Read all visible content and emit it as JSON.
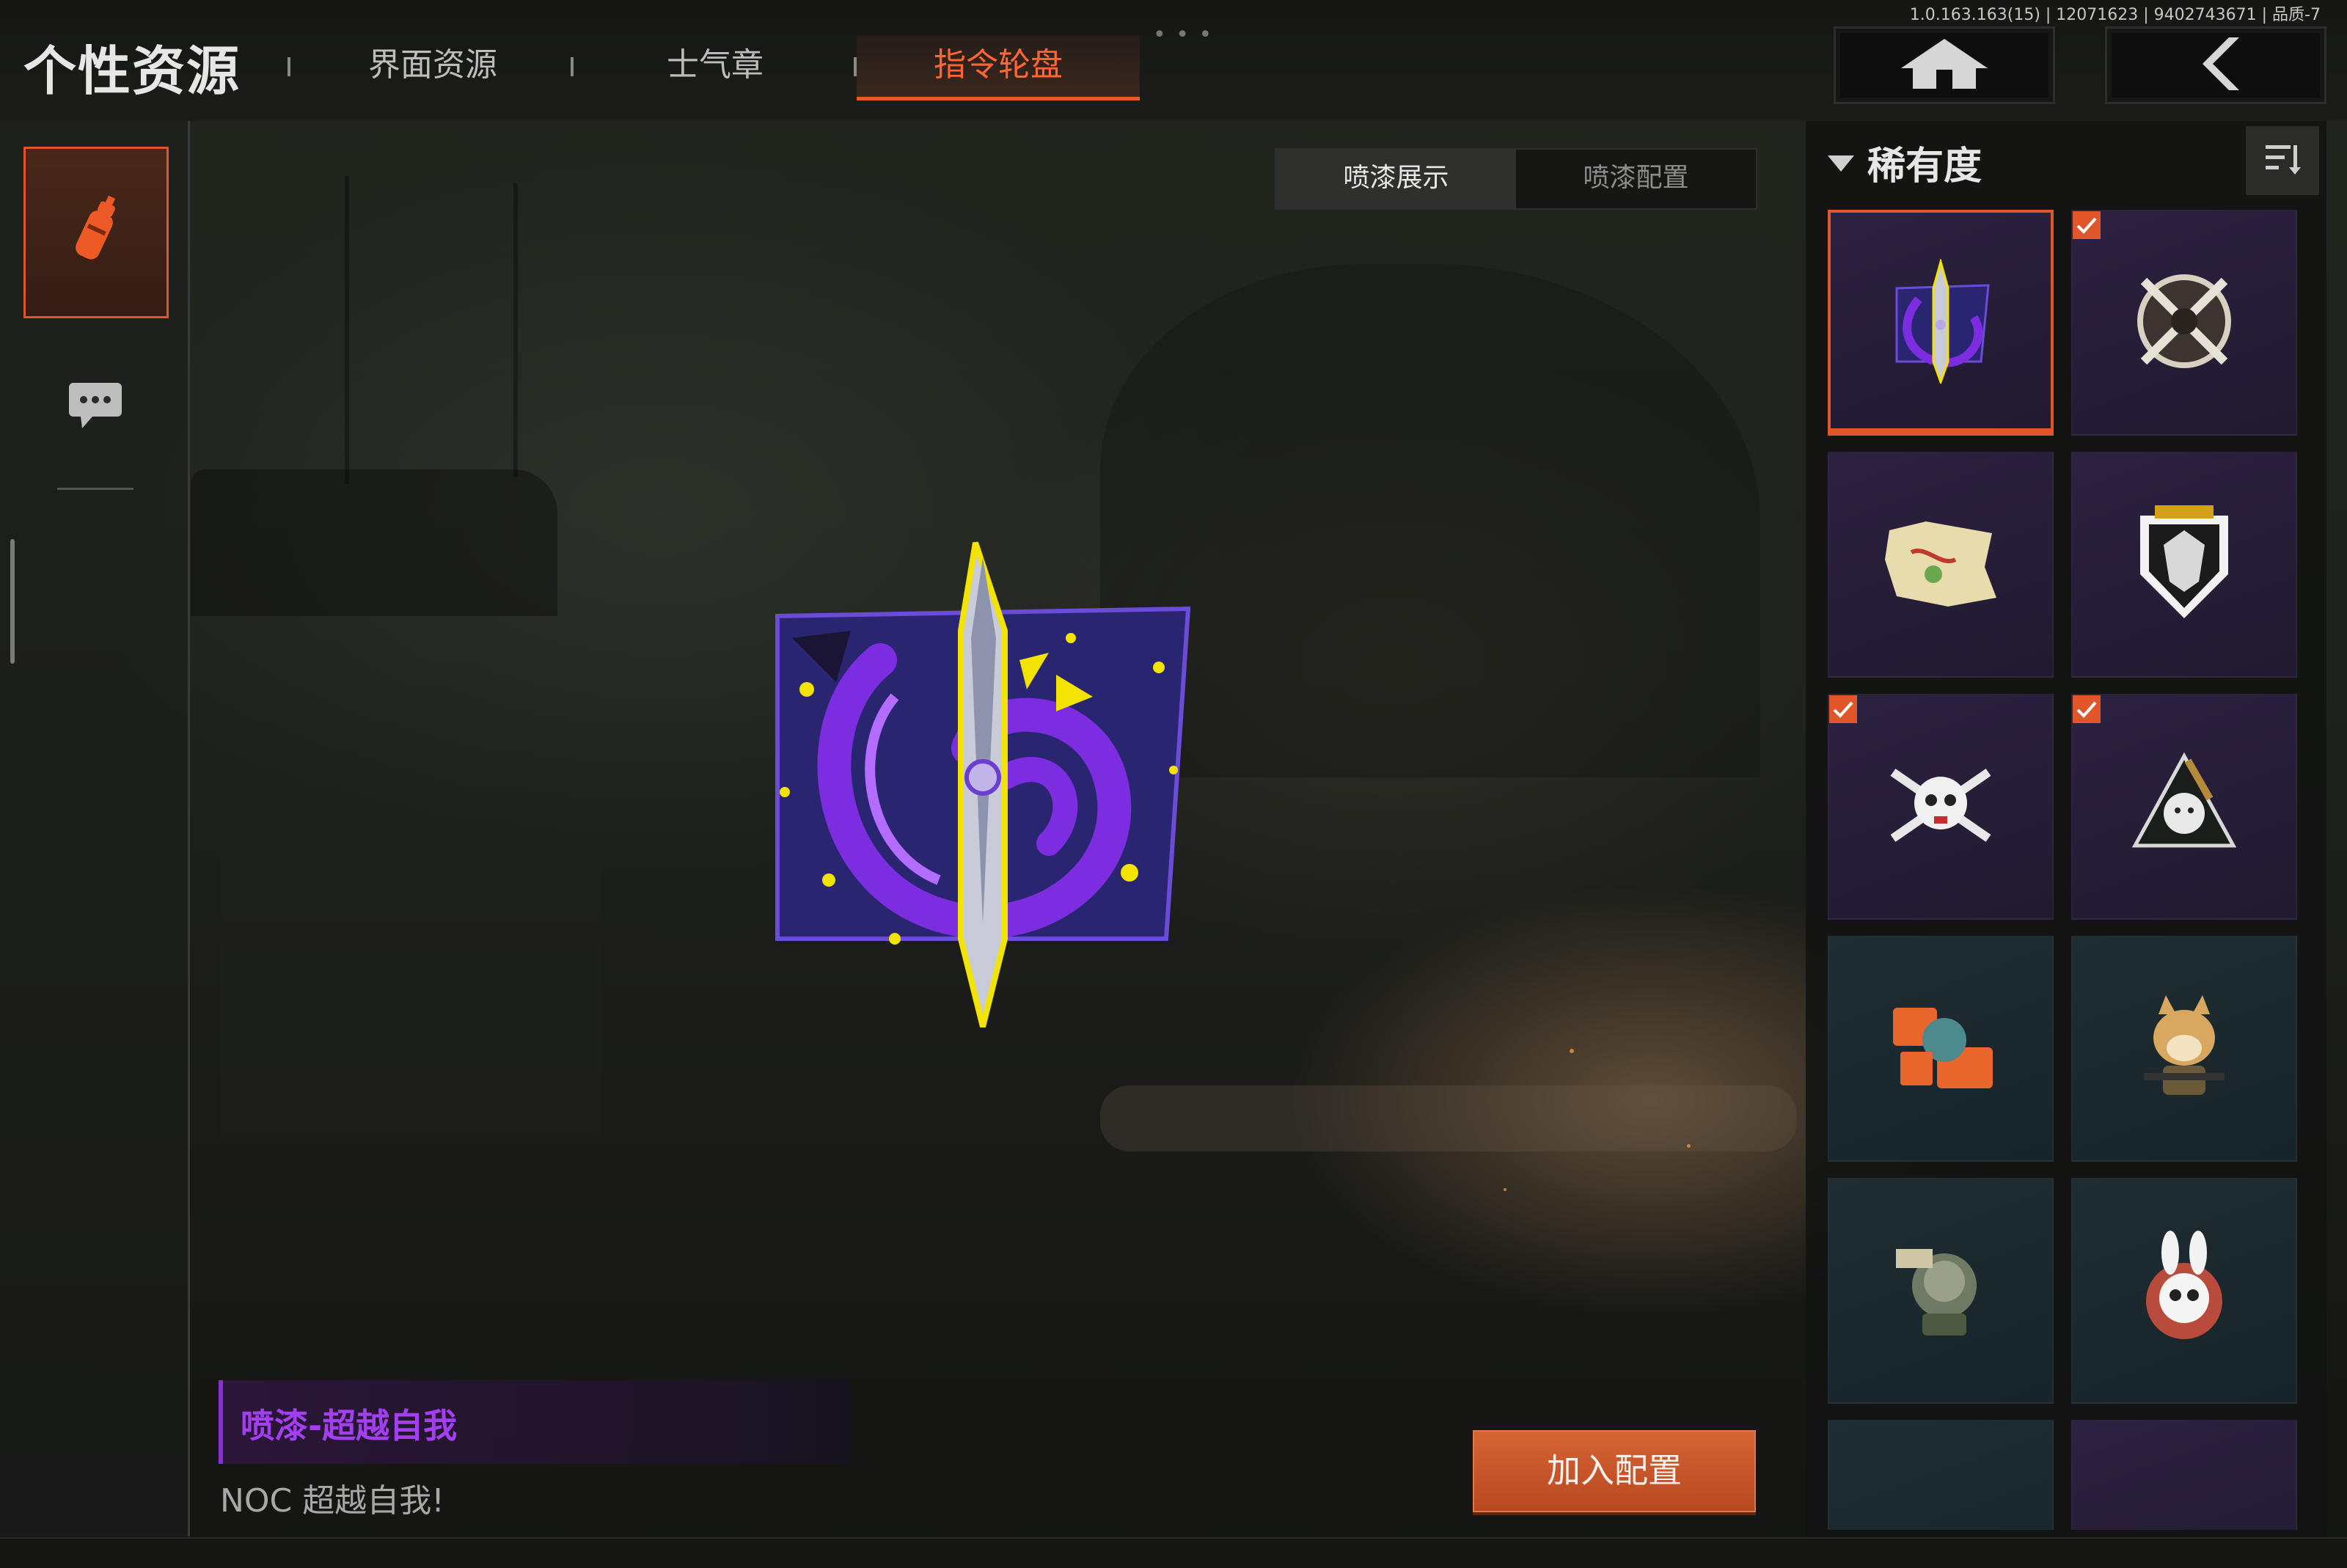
{
  "header": {
    "app_title": "个性资源",
    "tabs": [
      {
        "label": "界面资源",
        "active": false
      },
      {
        "label": "士气章",
        "active": false
      },
      {
        "label": "指令轮盘",
        "active": true
      }
    ],
    "more_dots": "• • •",
    "version": "1.0.163.163(15) | 12071623 | 9402743671 | 品质-7",
    "home_icon": "home-icon",
    "back_icon": "back-arrow-icon"
  },
  "left_rail": {
    "items": [
      {
        "icon": "spray-can-icon",
        "active": true
      },
      {
        "icon": "chat-bubble-icon",
        "active": false
      }
    ]
  },
  "segment": {
    "options": [
      "喷漆展示",
      "喷漆配置"
    ],
    "selected": "喷漆展示"
  },
  "item": {
    "name": "喷漆-超越自我",
    "description": "NOC 超越自我!",
    "rarity_color": "#a43ff0"
  },
  "actions": {
    "add_label": "加入配置"
  },
  "right_panel": {
    "filter_label": "稀有度",
    "sort_icon": "sort-icon",
    "items": [
      {
        "icon": "dagger-emblem-icon",
        "rarity": "purple",
        "checked": false,
        "selected": true
      },
      {
        "icon": "crossed-swords-emblem-icon",
        "rarity": "purple",
        "checked": true,
        "selected": false
      },
      {
        "icon": "torn-map-emblem-icon",
        "rarity": "purple",
        "checked": false,
        "selected": false
      },
      {
        "icon": "wolf-shield-emblem-icon",
        "rarity": "purple",
        "checked": false,
        "selected": false
      },
      {
        "icon": "skull-crossbones-emblem-icon",
        "rarity": "purple",
        "checked": true,
        "selected": false
      },
      {
        "icon": "tiger-triangle-emblem-icon",
        "rarity": "purple",
        "checked": true,
        "selected": false
      },
      {
        "icon": "graffiti-tag-emblem-icon",
        "rarity": "blue",
        "checked": false,
        "selected": false
      },
      {
        "icon": "doge-soldier-emblem-icon",
        "rarity": "blue",
        "checked": false,
        "selected": false
      },
      {
        "icon": "rat-soldier-emblem-icon",
        "rarity": "blue",
        "checked": false,
        "selected": false
      },
      {
        "icon": "rabbit-skull-emblem-icon",
        "rarity": "blue",
        "checked": false,
        "selected": false
      },
      {
        "icon": "helmet-emblem-icon",
        "rarity": "blue",
        "checked": false,
        "selected": false
      },
      {
        "icon": "creature-emblem-icon",
        "rarity": "purple",
        "checked": false,
        "selected": false
      }
    ]
  },
  "colors": {
    "accent": "#e0562a",
    "rarity_purple": "#2c2140",
    "rarity_blue": "#1f2d33"
  }
}
